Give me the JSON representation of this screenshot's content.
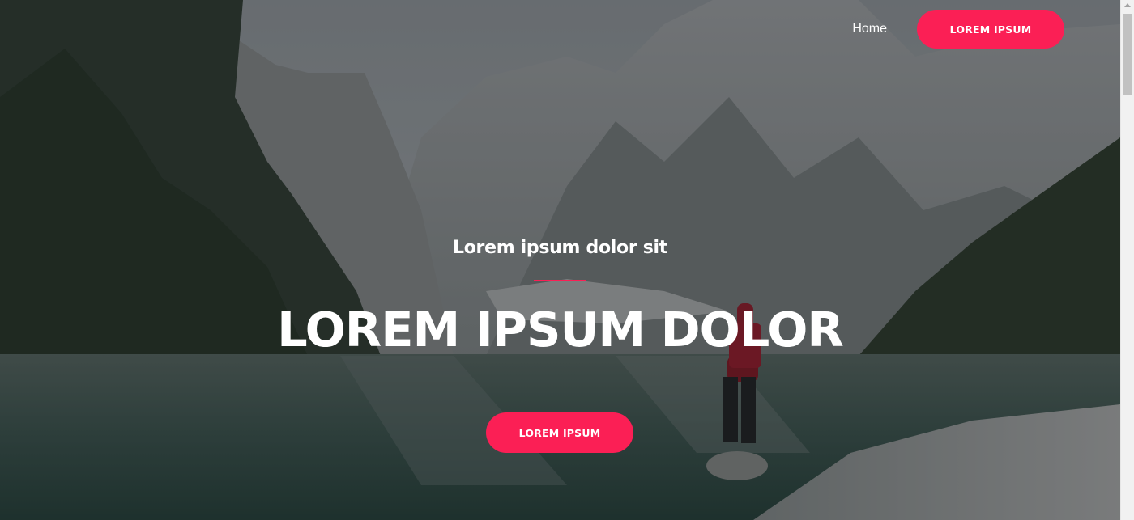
{
  "nav": {
    "home_label": "Home",
    "cta_label": "LOREM IPSUM"
  },
  "hero": {
    "subtitle": "Lorem ipsum dolor sit",
    "headline": "LOREM IPSUM DOLOR",
    "cta_label": "LOREM IPSUM"
  },
  "colors": {
    "accent": "#fb1f55",
    "text": "#ffffff"
  },
  "icons": {
    "scroll_up": "triangle-up"
  }
}
